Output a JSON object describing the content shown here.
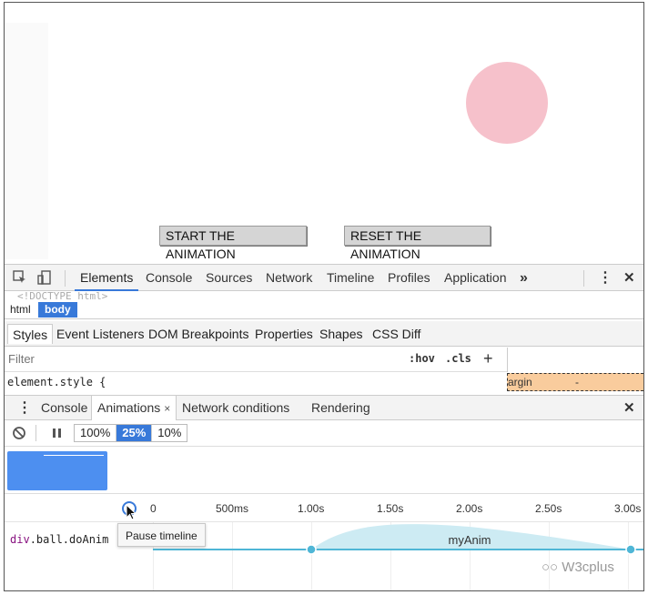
{
  "page": {
    "buttons": {
      "start": "START THE ANIMATION",
      "reset": "RESET THE ANIMATION"
    }
  },
  "devtools": {
    "tabs": [
      "Elements",
      "Console",
      "Sources",
      "Network",
      "Timeline",
      "Profiles",
      "Application"
    ],
    "more": "»",
    "menu": "⋮",
    "close": "✕",
    "doctype": "<!DOCTYPE html>",
    "breadcrumbs": {
      "html": "html",
      "body": "body"
    },
    "subtabs": [
      "Styles",
      "Event Listeners",
      "DOM Breakpoints",
      "Properties",
      "Shapes",
      "CSS Diff"
    ],
    "filter_placeholder": "Filter",
    "hov": ":hov",
    "cls": ".cls",
    "plus": "+",
    "element_style": "element.style {",
    "margin_label": "argin",
    "margin_value": "-"
  },
  "drawer": {
    "menu": "⋮",
    "tabs": [
      "Console",
      "Animations",
      "Network conditions",
      "Rendering"
    ],
    "tab_close": "×",
    "close": "✕"
  },
  "animations": {
    "rates": [
      "100%",
      "25%",
      "10%"
    ],
    "active_rate": "25%",
    "ticks": [
      "0",
      "500ms",
      "1.00s",
      "1.50s",
      "2.00s",
      "2.50s",
      "3.00s"
    ],
    "tooltip": "Pause timeline",
    "node": {
      "tag": "div",
      "classes": ".ball.doAnim"
    },
    "animation_name": "myAnim",
    "accent_color": "#3879d9",
    "curve_color": "#cdebf3",
    "line_color": "#4fb6d6"
  },
  "watermark": "W3cplus"
}
